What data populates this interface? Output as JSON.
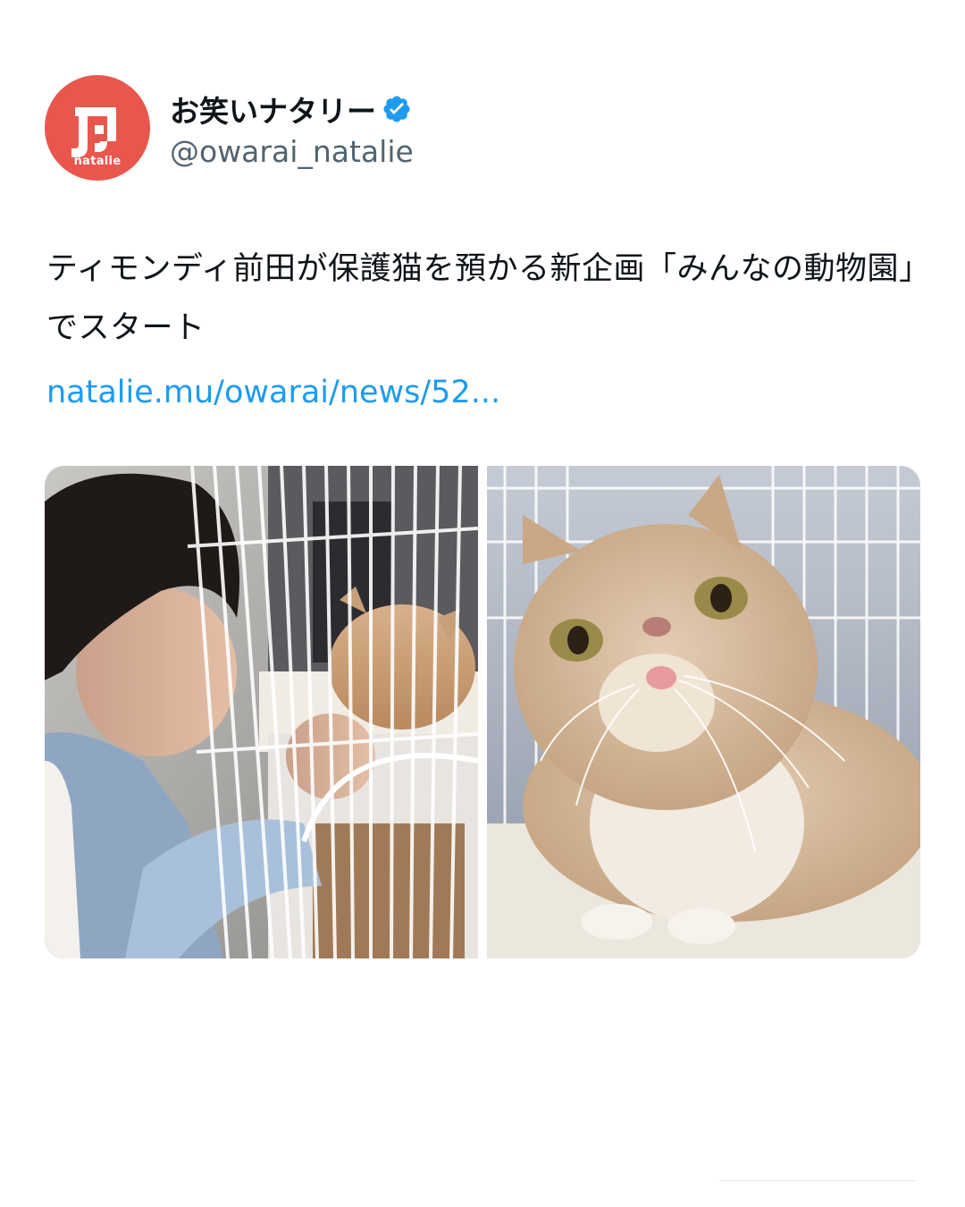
{
  "account": {
    "avatar_label": "natalie",
    "display_name": "お笑いナタリー",
    "handle": "@owarai_natalie",
    "verified": true,
    "avatar_color": "#e9564d",
    "verified_color": "#1d9bf0"
  },
  "tweet": {
    "text": "ティモンディ前田が保護猫を預かる新企画「みんなの動物園」でスタート",
    "link": "natalie.mu/owarai/news/52..."
  },
  "media": {
    "photos": [
      {
        "icon": "person-with-cat-photo"
      },
      {
        "icon": "cat-photo"
      }
    ]
  },
  "colors": {
    "text": "#0f1419",
    "secondary": "#536471",
    "link": "#1d9bf0",
    "background": "#ffffff"
  }
}
